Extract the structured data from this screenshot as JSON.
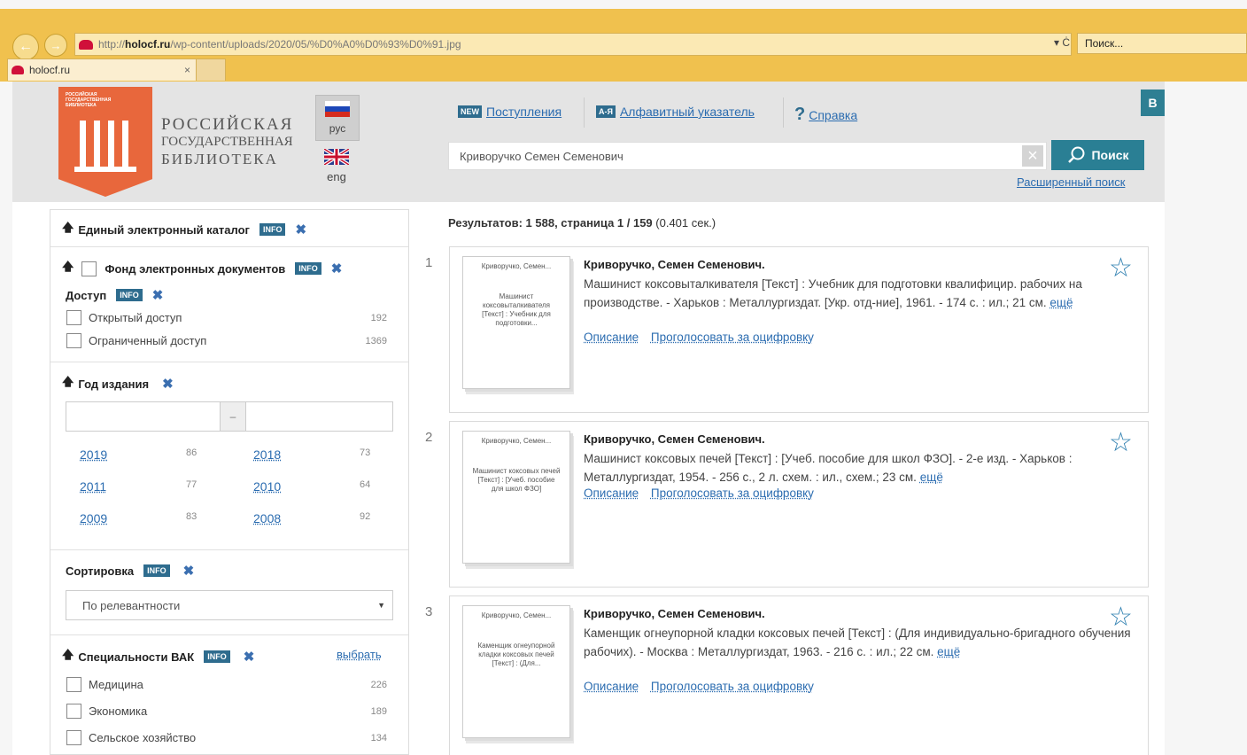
{
  "browser": {
    "url_prefix": "http://",
    "url_host": "holocf.ru",
    "url_path": "/wp-content/uploads/2020/05/%D0%A0%D0%93%D0%91.jpg",
    "addr_tools": "▾ Ċ",
    "search_placeholder": "Поиск...",
    "tab_title": "holocf.ru",
    "tab_close": "×"
  },
  "header": {
    "logo_tiny": "РОССИЙСКАЯ ГОСУДАРСТВЕННАЯ БИБЛИОТЕКА",
    "logo_line1": "РОССИЙСКАЯ",
    "logo_line2": "ГОСУДАРСТВЕННАЯ",
    "logo_line3": "БИБЛИОТЕКА",
    "lang_ru": "рус",
    "lang_en": "eng",
    "nav": [
      {
        "tag": "NEW",
        "label": "Поступления"
      },
      {
        "tag": "А-Я",
        "label": "Алфавитный указатель"
      },
      {
        "tag": "?",
        "label": "Справка"
      }
    ],
    "search_value": "Криворучко Семен Семенович",
    "search_button": "Поиск",
    "advanced_search": "Расширенный поиск",
    "corner_button": "В"
  },
  "sidebar": {
    "info_label": "INFO",
    "catalog_title": "Единый электронный каталог",
    "fund_title": "Фонд электронных документов",
    "access_title": "Доступ",
    "access_items": [
      {
        "label": "Открытый доступ",
        "count": "192"
      },
      {
        "label": "Ограниченный доступ",
        "count": "1369"
      }
    ],
    "year_title": "Год издания",
    "year_dash": "–",
    "years": [
      {
        "year": "2019",
        "count": "86"
      },
      {
        "year": "2018",
        "count": "73"
      },
      {
        "year": "2011",
        "count": "77"
      },
      {
        "year": "2010",
        "count": "64"
      },
      {
        "year": "2009",
        "count": "83"
      },
      {
        "year": "2008",
        "count": "92"
      }
    ],
    "sort_title": "Сортировка",
    "sort_value": "По релевантности",
    "vak_title": "Специальности ВАК",
    "vak_choose": "выбрать",
    "vak_items": [
      {
        "label": "Медицина",
        "count": "226"
      },
      {
        "label": "Экономика",
        "count": "189"
      },
      {
        "label": "Сельское хозяйство",
        "count": "134"
      }
    ]
  },
  "results": {
    "summary_bold": "Результатов: 1 588, страница 1 / 159",
    "summary_time": " (0.401 сек.)",
    "more_label": "ещё",
    "describe_label": "Описание",
    "vote_label": "Проголосовать за оцифровку",
    "items": [
      {
        "num": "1",
        "thumb_title": "Криворучко, Семен...",
        "thumb_text": "Машинист коксовыталкивателя [Текст] : Учебник для подготовки...",
        "author": "Криворучко, Семен Семенович.",
        "desc": "Машинист коксовыталкивателя [Текст] : Учебник для подготовки квалифицир. рабочих на производстве. - Харьков : Металлургиздат. [Укр. отд-ние], 1961. - 174 с. : ил.; 21 см."
      },
      {
        "num": "2",
        "thumb_title": "Криворучко, Семен...",
        "thumb_text": "Машинист коксовых печей [Текст] : [Учеб. пособие для школ ФЗО]",
        "author": "Криворучко, Семен Семенович.",
        "desc": "Машинист коксовых печей [Текст] : [Учеб. пособие для школ ФЗО]. - 2-е изд. - Харьков : Металлургиздат, 1954. - 256 с., 2 л. схем. : ил., схем.; 23 см."
      },
      {
        "num": "3",
        "thumb_title": "Криворучко, Семен...",
        "thumb_text": "Каменщик огнеупорной кладки коксовых печей [Текст] : (Для...",
        "author": "Криворучко, Семен Семенович.",
        "desc": "Каменщик огнеупорной кладки коксовых печей [Текст] : (Для индивидуально-бригадного обучения рабочих). - Москва : Металлургиздат, 1963. - 216 с. : ил.; 22 см."
      }
    ]
  }
}
